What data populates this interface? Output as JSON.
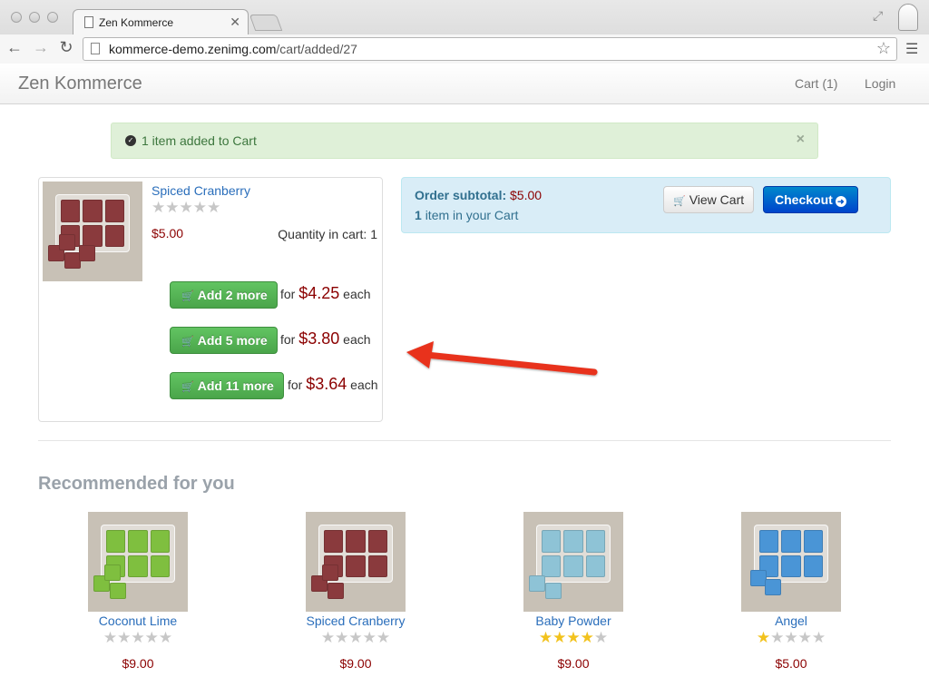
{
  "browser": {
    "tab_title": "Zen Kommerce",
    "url_host": "kommerce-demo.zenimg.com",
    "url_path": "/cart/added/27",
    "icons": [
      "back-icon",
      "forward-icon",
      "reload-icon",
      "page-icon",
      "star-icon",
      "menu-icon"
    ]
  },
  "navbar": {
    "brand": "Zen Kommerce",
    "cart_label": "Cart (1)",
    "login_label": "Login"
  },
  "alert": {
    "message": "1 item added to Cart",
    "close": "×"
  },
  "product": {
    "name": "Spiced Cranberry",
    "rating": 0,
    "price": "$5.00",
    "quantity_label": "Quantity in cart: 1",
    "color": "#8a3a3d",
    "offers": [
      {
        "button": "Add 2 more",
        "for": "for",
        "price": "$4.25",
        "each": "each"
      },
      {
        "button": "Add 5 more",
        "for": "for",
        "price": "$3.80",
        "each": "each"
      },
      {
        "button": "Add 11 more",
        "for": "for",
        "price": "$3.64",
        "each": "each"
      }
    ]
  },
  "order": {
    "subtotal_label": "Order subtotal:",
    "subtotal_value": "$5.00",
    "count": "1",
    "count_text": "item in your Cart",
    "view_cart": "View Cart",
    "checkout": "Checkout"
  },
  "recommended": {
    "title": "Recommended for you",
    "items": [
      {
        "name": "Coconut Lime",
        "rating": 0,
        "price": "$9.00",
        "color": "#7fbf3f"
      },
      {
        "name": "Spiced Cranberry",
        "rating": 0,
        "price": "$9.00",
        "color": "#8a3a3d"
      },
      {
        "name": "Baby Powder",
        "rating": 4,
        "price": "$9.00",
        "color": "#8ec3d6"
      },
      {
        "name": "Angel",
        "rating": 1,
        "price": "$5.00",
        "color": "#4a95d6"
      }
    ]
  },
  "colors": {
    "link": "#2a6ebb",
    "price": "#8b0000",
    "success_bg": "#dff0d8",
    "info_bg": "#d9edf7",
    "annotation_arrow": "#e8321e"
  }
}
